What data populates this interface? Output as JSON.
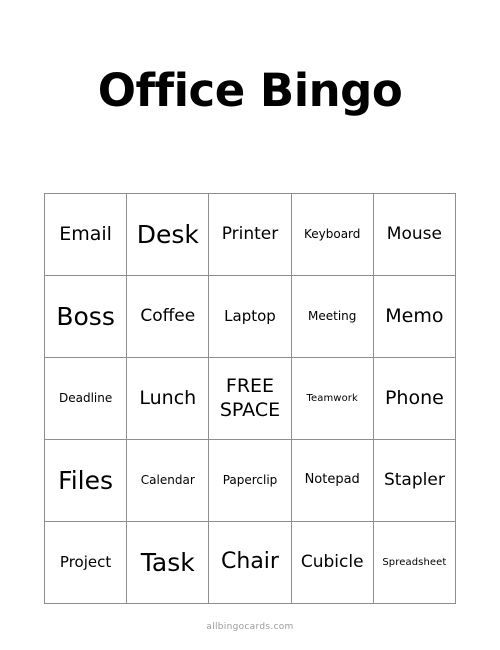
{
  "page": {
    "title": "Office Bingo",
    "background_color": "#ffffff",
    "text_color": "#000000",
    "grid_border_color": "#8e8e8e"
  },
  "footer": {
    "source_label": "allbingocards.com",
    "color": "#9b9b9b"
  },
  "grid": {
    "columns": 5,
    "rows": 5,
    "free_space_index": 12,
    "cells": [
      {
        "label": "Email",
        "size": "l"
      },
      {
        "label": "Desk",
        "size": "xxl"
      },
      {
        "label": "Printer",
        "size": "ml"
      },
      {
        "label": "Keyboard",
        "size": "s"
      },
      {
        "label": "Mouse",
        "size": "ml"
      },
      {
        "label": "Boss",
        "size": "xxl"
      },
      {
        "label": "Coffee",
        "size": "ml"
      },
      {
        "label": "Laptop",
        "size": "m"
      },
      {
        "label": "Meeting",
        "size": "s"
      },
      {
        "label": "Memo",
        "size": "l"
      },
      {
        "label": "Deadline",
        "size": "s"
      },
      {
        "label": "Lunch",
        "size": "l"
      },
      {
        "label": "FREE SPACE",
        "size": "free"
      },
      {
        "label": "Teamwork",
        "size": "xs"
      },
      {
        "label": "Phone",
        "size": "l"
      },
      {
        "label": "Files",
        "size": "xxl"
      },
      {
        "label": "Calendar",
        "size": "s"
      },
      {
        "label": "Paperclip",
        "size": "s"
      },
      {
        "label": "Notepad",
        "size": "sm"
      },
      {
        "label": "Stapler",
        "size": "ml"
      },
      {
        "label": "Project",
        "size": "m"
      },
      {
        "label": "Task",
        "size": "xxl"
      },
      {
        "label": "Chair",
        "size": "xl"
      },
      {
        "label": "Cubicle",
        "size": "ml"
      },
      {
        "label": "Spreadsheet",
        "size": "xs"
      }
    ]
  }
}
